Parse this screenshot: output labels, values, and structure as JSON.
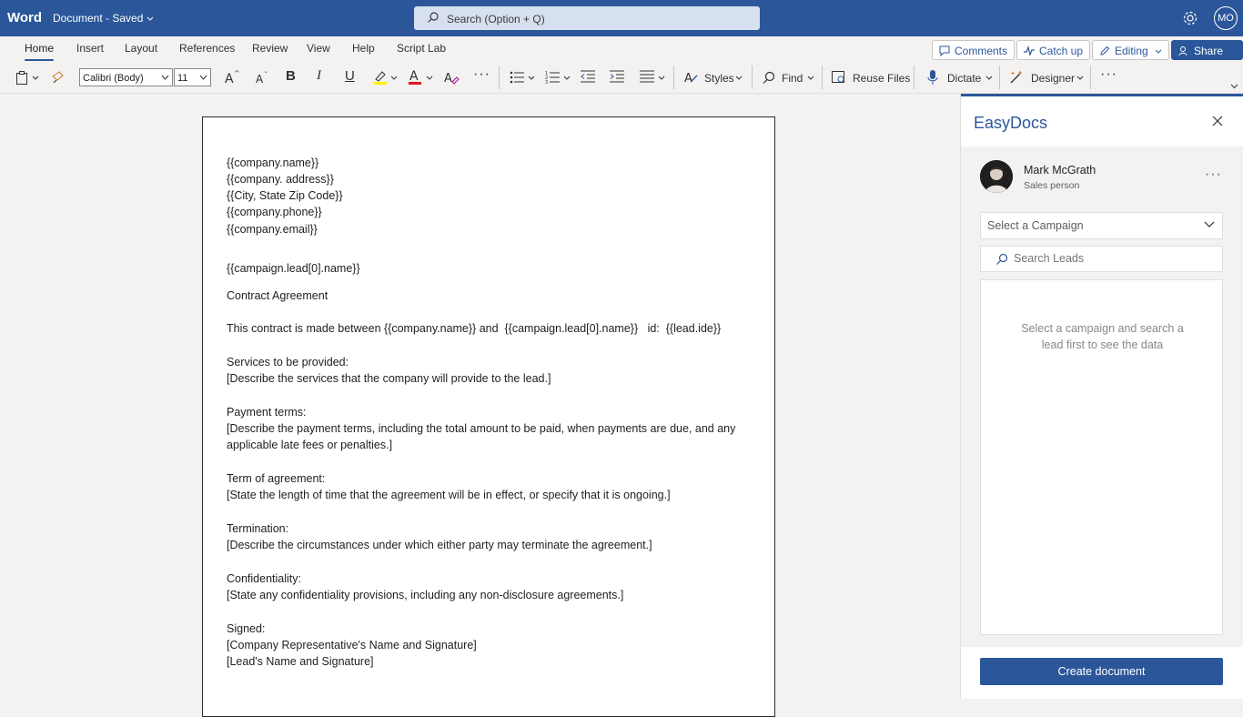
{
  "titlebar": {
    "app_name": "Word",
    "doc_name": "Document",
    "doc_sep": " - ",
    "doc_status": "Saved",
    "search_placeholder": "Search (Option + Q)",
    "avatar_initials": "MO"
  },
  "tabs": [
    "Home",
    "Insert",
    "Layout",
    "References",
    "Review",
    "View",
    "Help",
    "Script Lab"
  ],
  "actions": {
    "comments": "Comments",
    "catchup": "Catch up",
    "editing": "Editing",
    "share": "Share"
  },
  "ribbon": {
    "font_name": "Calibri (Body)",
    "font_size": "11",
    "bold": "B",
    "italic": "I",
    "underline": "U",
    "styles": "Styles",
    "find": "Find",
    "reuse_files": "Reuse Files",
    "dictate": "Dictate",
    "designer": "Designer"
  },
  "document": {
    "lines": [
      "{{company.name}}",
      "{{company. address}}",
      "{{City, State Zip Code}}",
      "{{company.phone}}",
      "{{company.email}}",
      "{{campaign.lead[0].name}}",
      "Contract Agreement",
      "This contract is made between {{company.name}} and  {{campaign.lead[0].name}}   id:  {{lead.ide}}",
      "Services to be provided:",
      "[Describe the services that the company will provide to the lead.]",
      "Payment terms:",
      "[Describe the payment terms, including the total amount to be paid, when payments are due, and any applicable late fees or penalties.]",
      "Term of agreement:",
      "[State the length of time that the agreement will be in effect, or specify that it is ongoing.]",
      "Termination:",
      "[Describe the circumstances under which either party may terminate the agreement.]",
      "Confidentiality:",
      "[State any confidentiality provisions, including any non-disclosure agreements.]",
      "Signed:",
      "[Company Representative's Name and Signature]",
      "[Lead's Name and Signature]"
    ]
  },
  "panel": {
    "title": "EasyDocs",
    "user_name": "Mark McGrath",
    "user_role": "Sales person",
    "campaign_placeholder": "Select a Campaign",
    "search_leads_placeholder": "Search Leads",
    "empty_message": "Select a campaign and search a lead first to see the data",
    "create_button": "Create document"
  },
  "colors": {
    "brand": "#2b579a",
    "panel_bg": "#f3f2f1"
  }
}
